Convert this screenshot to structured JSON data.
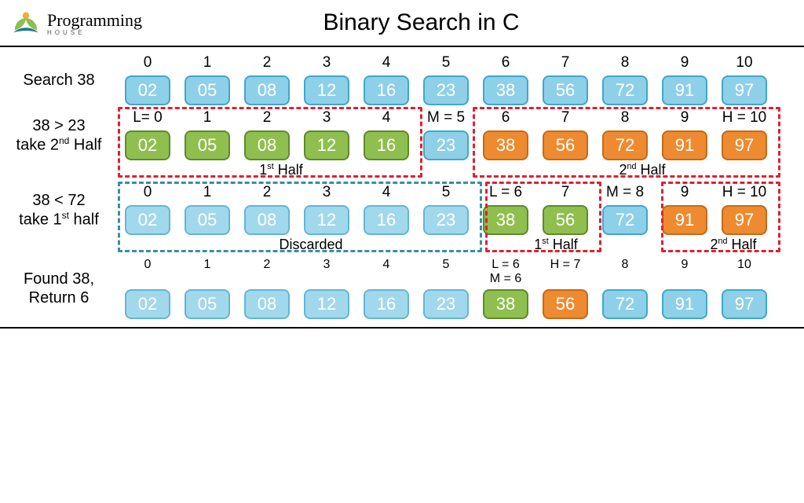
{
  "brand": {
    "name": "Programming",
    "sub": "HOUSE"
  },
  "title": "Binary Search in C",
  "target": 38,
  "array": [
    "02",
    "05",
    "08",
    "12",
    "16",
    "23",
    "38",
    "56",
    "72",
    "91",
    "97"
  ],
  "row1": {
    "label": "Search 38",
    "indices": [
      "0",
      "1",
      "2",
      "3",
      "4",
      "5",
      "6",
      "7",
      "8",
      "9",
      "10"
    ],
    "colors": [
      "blue",
      "blue",
      "blue",
      "blue",
      "blue",
      "blue",
      "blue",
      "blue",
      "blue",
      "blue",
      "blue"
    ]
  },
  "row2": {
    "label_html": "38 &gt; 23<br>take 2<sup>nd</sup> Half",
    "indices": [
      "L= 0",
      "1",
      "2",
      "3",
      "4",
      "M = 5",
      "6",
      "7",
      "8",
      "9",
      "H = 10"
    ],
    "colors": [
      "green",
      "green",
      "green",
      "green",
      "green",
      "blue",
      "orange",
      "orange",
      "orange",
      "orange",
      "orange"
    ],
    "caption1_html": "1<sup>st</sup> Half",
    "caption2_html": "2<sup>nd</sup> Half"
  },
  "row3": {
    "label_html": "38 &lt; 72<br>take 1<sup>st</sup> half",
    "indices": [
      "0",
      "1",
      "2",
      "3",
      "4",
      "5",
      "L = 6",
      "7",
      "M = 8",
      "9",
      "H = 10"
    ],
    "colors": [
      "blue2",
      "blue2",
      "blue2",
      "blue2",
      "blue2",
      "blue2",
      "green",
      "green",
      "blue",
      "orange",
      "orange"
    ],
    "caption_discarded": "Discarded",
    "caption1_html": "1<sup>st</sup> Half",
    "caption2_html": "2<sup>nd</sup> Half"
  },
  "row4": {
    "label_html": "Found 38,<br>Return 6",
    "indices": [
      "0",
      "1",
      "2",
      "3",
      "4",
      "5",
      "L = 6\nM = 6",
      "H = 7",
      "8",
      "9",
      "10"
    ],
    "colors": [
      "blue2",
      "blue2",
      "blue2",
      "blue2",
      "blue2",
      "blue2",
      "green",
      "orange",
      "blue",
      "blue",
      "blue"
    ]
  }
}
